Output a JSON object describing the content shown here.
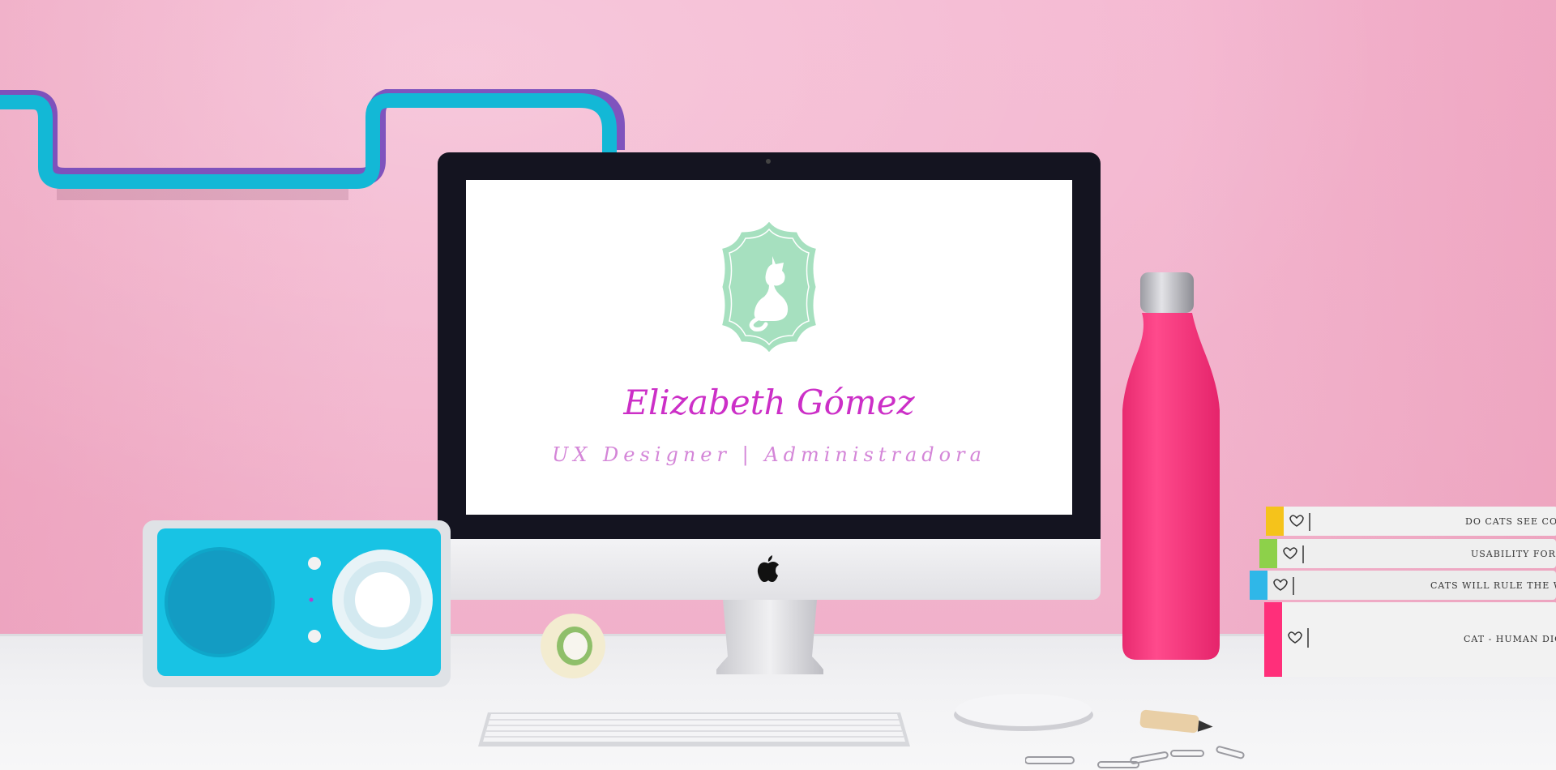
{
  "screen": {
    "name": "Elizabeth Gómez",
    "role": "UX Designer | Administradora"
  },
  "books": [
    {
      "title": "DO CATS SEE COLOR?",
      "accent": "#f5c31b"
    },
    {
      "title": "USABILITY FOR C",
      "accent": "#8dd14a"
    },
    {
      "title": "CATS WILL RULE THE WORL",
      "accent": "#2fb7e8"
    },
    {
      "title": "CAT - HUMAN DICT",
      "accent": "#ff2f7a"
    }
  ],
  "colors": {
    "wall": "#f4b6d0",
    "brand_magenta": "#cc2fc7",
    "badge_mint": "#a6e0bf",
    "bottle_pink": "#ff2e77",
    "speaker_cyan": "#18c3e4"
  }
}
